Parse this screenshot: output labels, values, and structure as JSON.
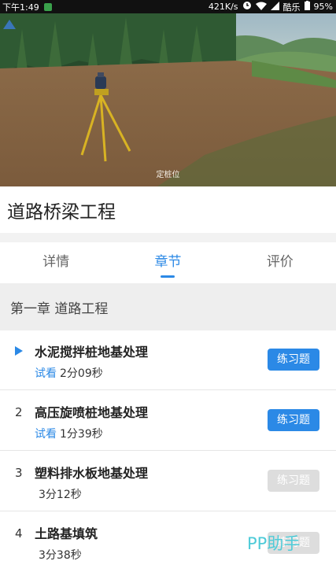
{
  "status_bar": {
    "time": "下午1:49",
    "network_speed": "421K/s",
    "carrier": "酷乐",
    "battery": "95%"
  },
  "video": {
    "logo_text": "",
    "caption": "定桩位"
  },
  "course": {
    "title": "道路桥梁工程"
  },
  "tabs": [
    {
      "label": "详情",
      "active": false
    },
    {
      "label": "章节",
      "active": true
    },
    {
      "label": "评价",
      "active": false
    }
  ],
  "chapter": {
    "title": "第一章  道路工程"
  },
  "lessons": [
    {
      "index": "",
      "playing": true,
      "title": "水泥搅拌桩地基处理",
      "trial": "试看",
      "duration": "2分09秒",
      "practice": "练习题",
      "practice_enabled": true
    },
    {
      "index": "2",
      "playing": false,
      "title": "高压旋喷桩地基处理",
      "trial": "试看",
      "duration": "1分39秒",
      "practice": "练习题",
      "practice_enabled": true
    },
    {
      "index": "3",
      "playing": false,
      "title": "塑料排水板地基处理",
      "trial": "",
      "duration": "3分12秒",
      "practice": "练习题",
      "practice_enabled": false
    },
    {
      "index": "4",
      "playing": false,
      "title": "土路基填筑",
      "trial": "",
      "duration": "3分38秒",
      "practice": "练习题",
      "practice_enabled": false
    }
  ],
  "watermark": "PP助手",
  "colors": {
    "accent": "#2b89e6",
    "disabled": "#dddddd",
    "divider": "#f2f2f2",
    "chapter_bg": "#eeeeee"
  }
}
